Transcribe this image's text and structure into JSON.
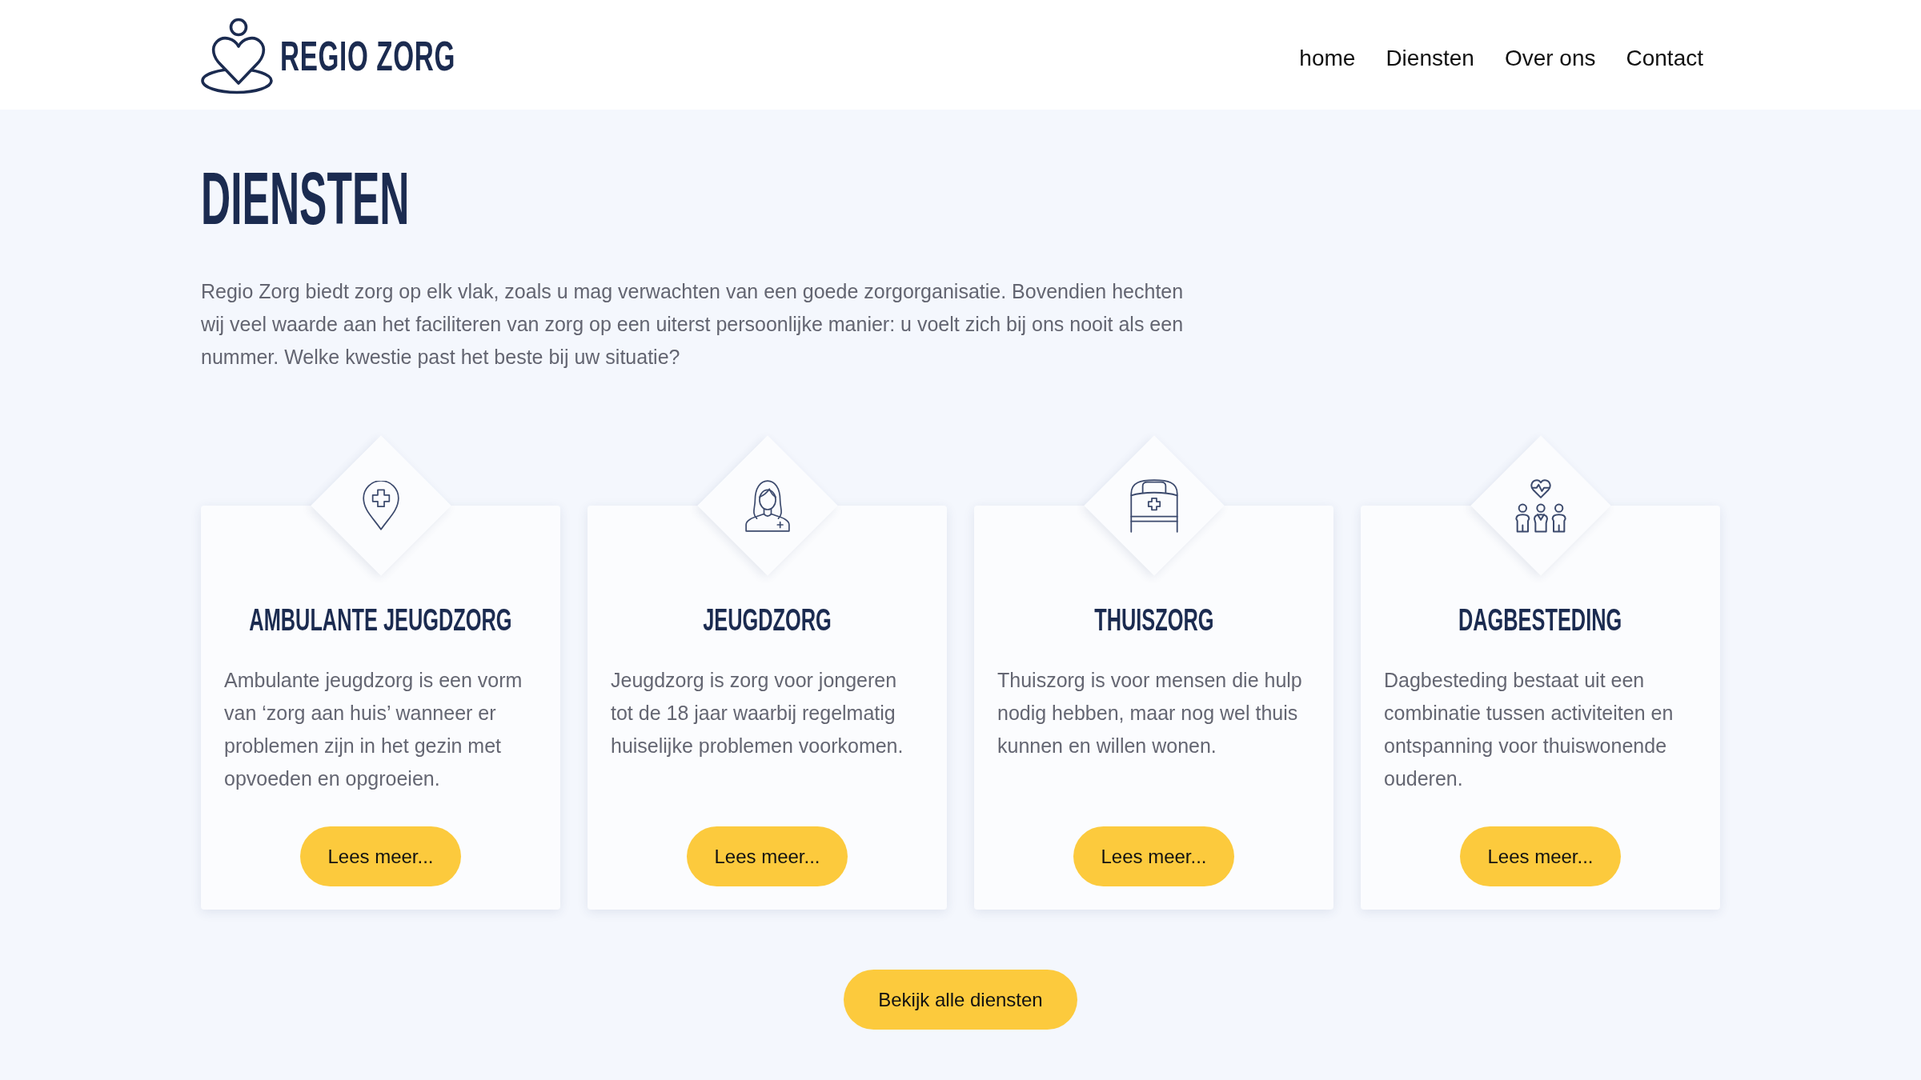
{
  "header": {
    "logo_text": "REGIO ZORG",
    "nav": [
      "home",
      "Diensten",
      "Over ons",
      "Contact"
    ]
  },
  "intro": {
    "title": "DIENSTEN",
    "text": "Regio Zorg biedt zorg op elk vlak, zoals u mag verwachten van een goede zorgorganisatie. Bovendien hechten wij veel waarde aan het faciliteren van zorg op een uiterst persoonlijke manier: u voelt zich bij ons nooit als een nummer. Welke kwestie past het beste bij uw situatie?"
  },
  "services": [
    {
      "title": "AMBULANTE JEUGDZORG",
      "description": "Ambulante jeugdzorg is een vorm van ‘zorg aan huis’ wanneer er problemen zijn in het gezin met opvoeden en opgroeien.",
      "button": "Lees meer..."
    },
    {
      "title": "JEUGDZORG",
      "description": "Jeugdzorg is zorg voor jongeren tot de 18 jaar waarbij regelmatig huiselijke problemen voorkomen.",
      "button": "Lees meer..."
    },
    {
      "title": "THUISZORG",
      "description": "Thuiszorg is voor mensen die hulp nodig hebben, maar nog wel thuis kunnen en willen wonen.",
      "button": "Lees meer..."
    },
    {
      "title": "DAGBESTEDING",
      "description": "Dagbesteding bestaat uit een combinatie tussen activiteiten en ontspanning voor thuiswonende ouderen.",
      "button": "Lees meer..."
    }
  ],
  "all_services_button": "Bekijk alle diensten"
}
